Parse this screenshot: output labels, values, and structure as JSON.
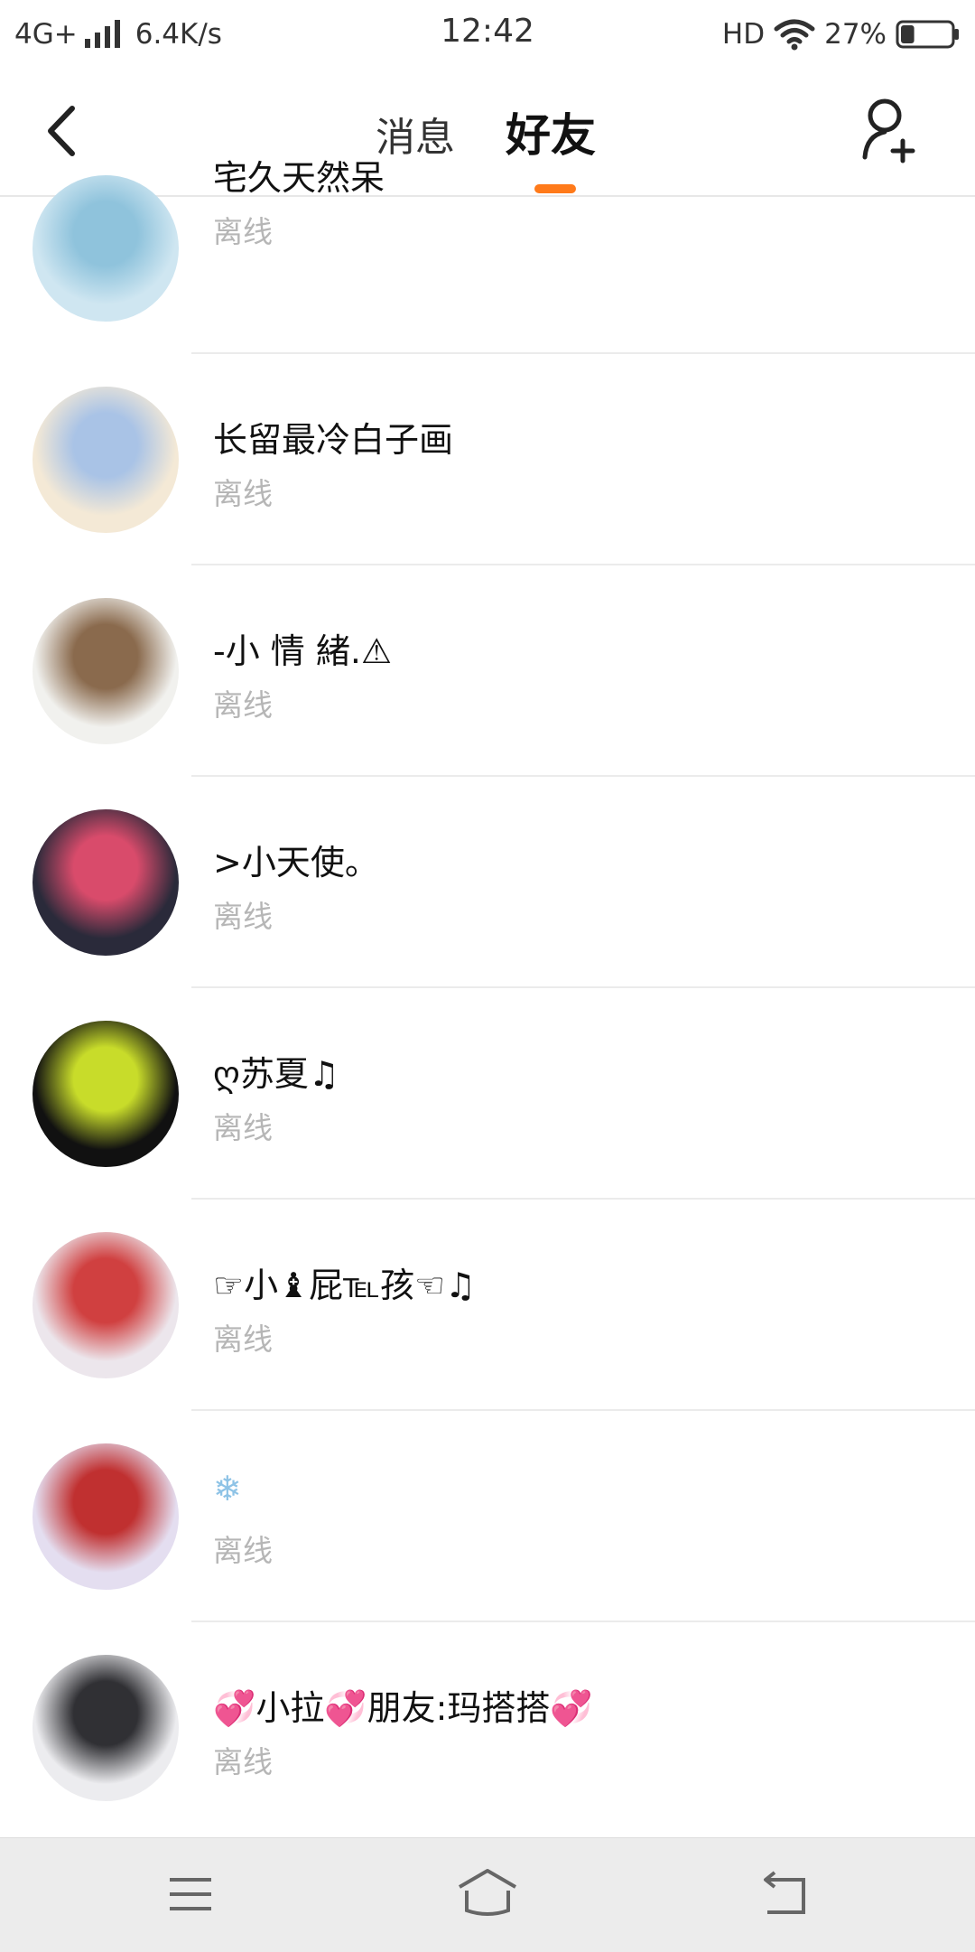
{
  "status_bar": {
    "network": "4G+",
    "speed": "6.4K/s",
    "time": "12:42",
    "hd": "HD",
    "battery": "27%",
    "battery_level": 0.27
  },
  "header": {
    "tabs": [
      {
        "label": "消息",
        "selected": false
      },
      {
        "label": "好友",
        "selected": true
      }
    ],
    "accent_color": "#ff7a1a",
    "back_icon": "chevron-left-icon",
    "add_icon": "add-friend-icon"
  },
  "friends": [
    {
      "name": "宅久天然呆",
      "status": "离线",
      "avatar_colors": [
        "#cfe6f1",
        "#8fc3dc"
      ]
    },
    {
      "name": "长留最冷白子画",
      "status": "离线",
      "avatar_colors": [
        "#f4e9d6",
        "#a9c3e6"
      ]
    },
    {
      "name": "-小 情 緒.⚠",
      "status": "离线",
      "avatar_colors": [
        "#f1f1ee",
        "#8a6a4d"
      ]
    },
    {
      "name": ">小天使。",
      "status": "离线",
      "avatar_colors": [
        "#2a2a3a",
        "#d94b6b"
      ]
    },
    {
      "name": "ღ苏夏♫",
      "status": "离线",
      "avatar_colors": [
        "#111111",
        "#c8dc2a"
      ]
    },
    {
      "name": "☞小♝屁℡孩☜♫",
      "status": "离线",
      "avatar_colors": [
        "#ece6ec",
        "#d04040"
      ]
    },
    {
      "name": "❄",
      "status": "离线",
      "avatar_colors": [
        "#e4def0",
        "#c03030"
      ]
    },
    {
      "name": "💞小拉💞朋友:玛搭搭💞",
      "status": "离线",
      "avatar_colors": [
        "#ececef",
        "#303034"
      ]
    }
  ],
  "nav_bar": {
    "icons": [
      "menu-icon",
      "home-icon",
      "back-icon"
    ]
  }
}
